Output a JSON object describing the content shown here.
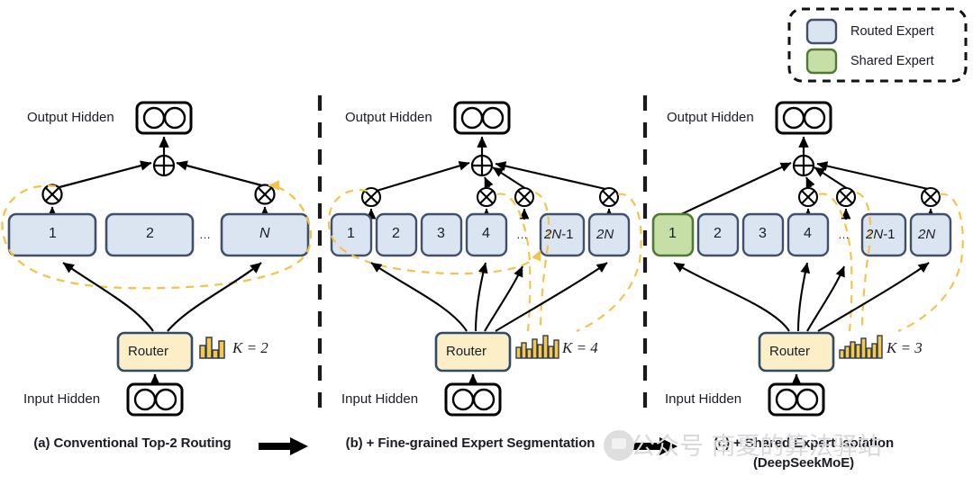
{
  "legend": {
    "items": [
      {
        "label": "Routed Expert",
        "color": "#dbe5f1",
        "border": "#41506b",
        "icon": "rounded-square-swatch"
      },
      {
        "label": "Shared Expert",
        "color": "#c6dfa7",
        "border": "#4e7a33",
        "icon": "rounded-square-swatch"
      }
    ]
  },
  "panels": [
    {
      "id": "a",
      "output_label": "Output Hidden",
      "input_label": "Input Hidden",
      "router_label": "Router",
      "k_label": "K = 2",
      "k_value": 2,
      "bar_icon_values": [
        0.45,
        1.0,
        0.3,
        0.8
      ],
      "experts": [
        {
          "label": "1",
          "italic": false,
          "type": "routed",
          "selected": true
        },
        {
          "label": "2",
          "italic": false,
          "type": "routed",
          "selected": false
        },
        {
          "label": "…",
          "italic": false,
          "type": "ellipsis",
          "selected": false
        },
        {
          "label": "N",
          "italic": true,
          "type": "routed",
          "selected": true
        }
      ],
      "caption": "(a) Conventional Top-2 Routing",
      "caption_line2": ""
    },
    {
      "id": "b",
      "output_label": "Output Hidden",
      "input_label": "Input Hidden",
      "router_label": "Router",
      "k_label": "K = 4",
      "k_value": 4,
      "bar_icon_values": [
        0.4,
        0.62,
        0.35,
        0.85,
        0.55,
        1.0,
        0.45,
        0.78
      ],
      "experts": [
        {
          "label": "1",
          "italic": false,
          "type": "routed",
          "selected": true
        },
        {
          "label": "2",
          "italic": false,
          "type": "routed",
          "selected": false
        },
        {
          "label": "3",
          "italic": false,
          "type": "routed",
          "selected": false
        },
        {
          "label": "4",
          "italic": false,
          "type": "routed",
          "selected": true
        },
        {
          "label": "…",
          "italic": false,
          "type": "ellipsis",
          "selected": true
        },
        {
          "label": "2N-1",
          "italic": true,
          "type": "routed",
          "selected": false
        },
        {
          "label": "2N",
          "italic": true,
          "type": "routed",
          "selected": true
        }
      ],
      "caption": "(b) + Fine-grained Expert Segmentation",
      "caption_line2": ""
    },
    {
      "id": "c",
      "output_label": "Output Hidden",
      "input_label": "Input Hidden",
      "router_label": "Router",
      "k_label": "K = 3",
      "k_value": 3,
      "bar_icon_values": [
        0.3,
        0.5,
        0.72,
        0.62,
        0.9,
        0.42,
        0.58,
        1.0
      ],
      "experts": [
        {
          "label": "1",
          "italic": false,
          "type": "shared",
          "selected": true
        },
        {
          "label": "2",
          "italic": false,
          "type": "routed",
          "selected": false
        },
        {
          "label": "3",
          "italic": false,
          "type": "routed",
          "selected": false
        },
        {
          "label": "4",
          "italic": false,
          "type": "routed",
          "selected": true
        },
        {
          "label": "…",
          "italic": false,
          "type": "ellipsis",
          "selected": true
        },
        {
          "label": "2N-1",
          "italic": true,
          "type": "routed",
          "selected": false
        },
        {
          "label": "2N",
          "italic": true,
          "type": "routed",
          "selected": true
        }
      ],
      "caption": "(c) + Shared Expert Isolation",
      "caption_line2": "(DeepSeekMoE)"
    }
  ],
  "symbols": {
    "sum": "⊕",
    "multiply": "⊗",
    "arrow_between_panels": "thick-right-arrow"
  },
  "watermark": {
    "text": "公众号 南夏的算法驿站",
    "color": "#d9d9d9"
  },
  "colors": {
    "routed_fill": "#dbe5f1",
    "routed_border": "#41506b",
    "shared_fill": "#c6dfa7",
    "shared_border": "#4e7a33",
    "router_fill": "#fcefc8",
    "router_border": "#2f4a6b",
    "gate_dashed": "#f5c24b",
    "line": "#000000",
    "divider": "#1a1a1a"
  }
}
